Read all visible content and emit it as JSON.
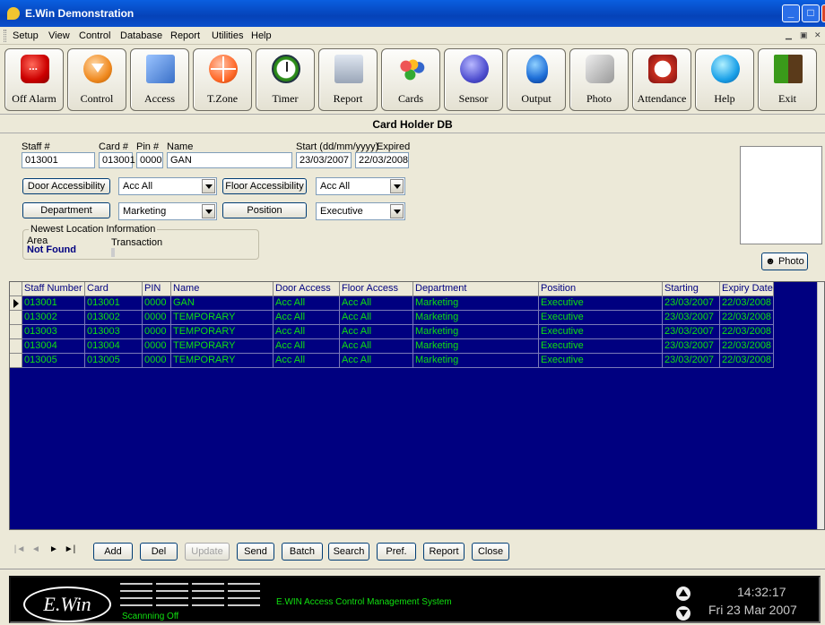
{
  "window": {
    "title": "E.Win Demonstration"
  },
  "menu": [
    "Setup",
    "View",
    "Control",
    "Database",
    "Report",
    "Utilities",
    "Help"
  ],
  "toolbar": [
    {
      "label": "Off Alarm",
      "icon": "alarm-icon"
    },
    {
      "label": "Control",
      "icon": "control-icon"
    },
    {
      "label": "Access",
      "icon": "access-icon"
    },
    {
      "label": "T.Zone",
      "icon": "time-zone-icon"
    },
    {
      "label": "Timer",
      "icon": "timer-icon"
    },
    {
      "label": "Report",
      "icon": "report-icon"
    },
    {
      "label": "Cards",
      "icon": "cards-icon"
    },
    {
      "label": "Sensor",
      "icon": "sensor-icon"
    },
    {
      "label": "Output",
      "icon": "output-icon"
    },
    {
      "label": "Photo",
      "icon": "photo-icon"
    },
    {
      "label": "Attendance",
      "icon": "attendance-icon"
    },
    {
      "label": "Help",
      "icon": "help-icon"
    },
    {
      "label": "Exit",
      "icon": "exit-icon"
    }
  ],
  "section_title": "Card Holder DB",
  "form": {
    "staff_label": "Staff #",
    "card_label": "Card #",
    "pin_label": "Pin #",
    "name_label": "Name",
    "start_label": "Start (dd/mm/yyyy)",
    "expired_label": "Expired",
    "staff": "013001",
    "card": "013001",
    "pin": "0000",
    "name": "GAN",
    "start": "23/03/2007",
    "expired": "22/03/2008",
    "door_btn": "Door Accessibility",
    "door_value": "Acc All",
    "floor_btn": "Floor Accessibility",
    "floor_value": "Acc All",
    "dept_btn": "Department",
    "dept_value": "Marketing",
    "pos_btn": "Position",
    "pos_value": "Executive",
    "location_title": "Newest Location Information",
    "area_label": "Area",
    "area_value": "Not Found",
    "transaction_label": "Transaction",
    "photo_btn": "Photo"
  },
  "grid": {
    "columns": [
      "Staff Number",
      "Card Number",
      "PIN",
      "Name",
      "Door Access",
      "Floor Access",
      "Department",
      "Position",
      "Starting Date",
      "Expiry Date"
    ],
    "rows": [
      [
        "013001",
        "013001",
        "0000",
        "GAN",
        "Acc All",
        "Acc All",
        "Marketing",
        "Executive",
        "23/03/2007",
        "22/03/2008"
      ],
      [
        "013002",
        "013002",
        "0000",
        "TEMPORARY",
        "Acc All",
        "Acc All",
        "Marketing",
        "Executive",
        "23/03/2007",
        "22/03/2008"
      ],
      [
        "013003",
        "013003",
        "0000",
        "TEMPORARY",
        "Acc All",
        "Acc All",
        "Marketing",
        "Executive",
        "23/03/2007",
        "22/03/2008"
      ],
      [
        "013004",
        "013004",
        "0000",
        "TEMPORARY",
        "Acc All",
        "Acc All",
        "Marketing",
        "Executive",
        "23/03/2007",
        "22/03/2008"
      ],
      [
        "013005",
        "013005",
        "0000",
        "TEMPORARY",
        "Acc All",
        "Acc All",
        "Marketing",
        "Executive",
        "23/03/2007",
        "22/03/2008"
      ]
    ]
  },
  "actions": [
    "Add",
    "Del",
    "Update",
    "Send",
    "Batch",
    "Search",
    "Pref.",
    "Report",
    "Close"
  ],
  "status": {
    "logo": "E.Win",
    "scan": "Scannning Off",
    "system": "E.WIN Access Control Management System",
    "time": "14:32:17",
    "date": "Fri  23 Mar 2007"
  },
  "colors": {
    "grid_bg": "#000080",
    "grid_text": "#10e010",
    "titlebar": "#0542b8"
  }
}
